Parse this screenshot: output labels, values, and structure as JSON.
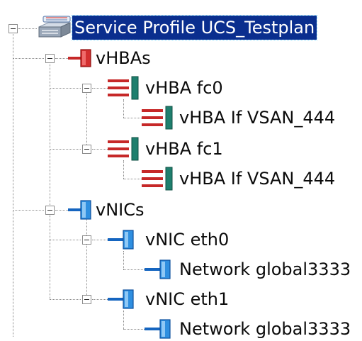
{
  "tree": {
    "root": {
      "label": "Service Profile UCS_Testplan",
      "icon": "server-icon",
      "selected": true
    },
    "vhbas": {
      "label": "vHBAs",
      "icon": "vhba-group-icon",
      "children": [
        {
          "label": "vHBA fc0",
          "icon": "vhba-icon",
          "child": {
            "label": "vHBA If VSAN_444",
            "icon": "vhba-interface-icon"
          }
        },
        {
          "label": "vHBA fc1",
          "icon": "vhba-icon",
          "child": {
            "label": "vHBA If VSAN_444",
            "icon": "vhba-interface-icon"
          }
        }
      ]
    },
    "vnics": {
      "label": "vNICs",
      "icon": "vnic-group-icon",
      "children": [
        {
          "label": "vNIC eth0",
          "icon": "vnic-icon",
          "child": {
            "label": "Network global3333",
            "icon": "network-icon"
          }
        },
        {
          "label": "vNIC eth1",
          "icon": "vnic-icon",
          "child": {
            "label": "Network global3333",
            "icon": "network-icon"
          }
        }
      ]
    }
  },
  "colors": {
    "selection": "#0a2e8e",
    "vhba_red": "#d42a2a",
    "vhba_teal": "#1f7f6e",
    "vnic_blue": "#1e88d8"
  }
}
